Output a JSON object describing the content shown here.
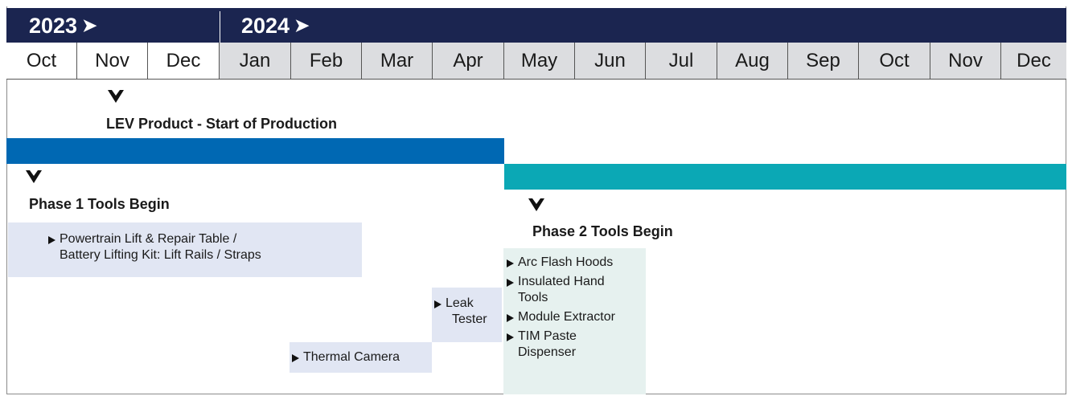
{
  "years": [
    {
      "label": "2023"
    },
    {
      "label": "2024"
    }
  ],
  "months": [
    "Oct",
    "Nov",
    "Dec",
    "Jan",
    "Feb",
    "Mar",
    "Apr",
    "May",
    "Jun",
    "Jul",
    "Aug",
    "Sep",
    "Oct",
    "Nov",
    "Dec"
  ],
  "milestones": {
    "production": "LEV Product - Start of Production",
    "phase1": "Phase 1 Tools Begin",
    "phase2": "Phase 2 Tools Begin"
  },
  "colors": {
    "year_bar": "#1b2550",
    "phase1_bar": "#0068b3",
    "phase2_bar": "#0ba8b5",
    "phase1_box": "#e1e6f3",
    "phase2_box": "#e6f1ef"
  },
  "phase1_tools": {
    "powertrain": [
      "Powertrain Lift & Repair Table /",
      "Battery Lifting Kit: Lift Rails / Straps"
    ],
    "leak_tester": [
      "Leak",
      "Tester"
    ],
    "thermal_camera": "Thermal Camera"
  },
  "phase2_tools": [
    [
      "Arc Flash Hoods"
    ],
    [
      "Insulated Hand",
      "Tools"
    ],
    [
      "Module Extractor"
    ],
    [
      "TIM Paste",
      "Dispenser"
    ]
  ]
}
